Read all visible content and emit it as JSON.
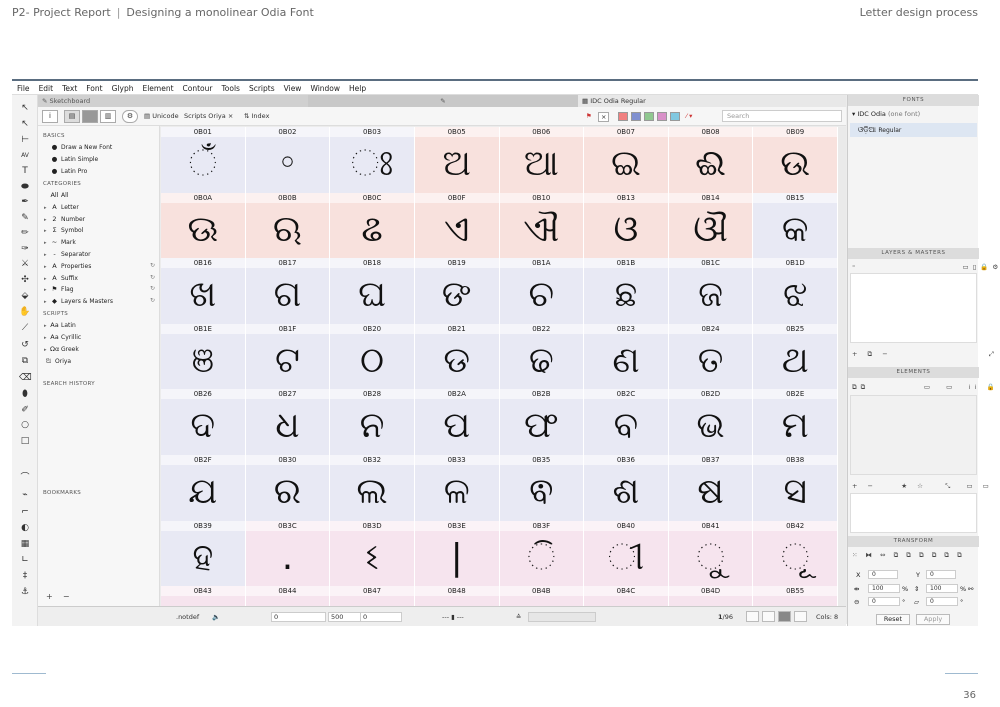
{
  "page": {
    "header_left": "P2- Project Report",
    "header_separator": "|",
    "header_middle": "Designing a monolinear Odia Font",
    "header_right": "Letter design process",
    "page_number": "36"
  },
  "menu": [
    "File",
    "Edit",
    "Text",
    "Font",
    "Glyph",
    "Element",
    "Contour",
    "Tools",
    "Scripts",
    "View",
    "Window",
    "Help"
  ],
  "tabs": {
    "sketchboard": "Sketchboard",
    "middle": "✎ ",
    "font": "IDC Odia Regular"
  },
  "viewbar": {
    "info_btn": "i",
    "unicode": "Unicode",
    "scripts": "Scripts Oriya",
    "scripts_close": "×",
    "index": "Index",
    "search_placeholder": "Search",
    "swatch_colors": [
      "#f08080",
      "#8090d0",
      "#90c890",
      "#d890c8",
      "#80c8e0"
    ]
  },
  "sidebar": {
    "basics_head": "BASICS",
    "basics": [
      "Draw a New Font",
      "Latin Simple",
      "Latin Pro"
    ],
    "categories_head": "CATEGORIES",
    "categories": [
      {
        "icon": "All",
        "label": "All"
      },
      {
        "icon": "A",
        "label": "Letter"
      },
      {
        "icon": "2",
        "label": "Number"
      },
      {
        "icon": "Σ",
        "label": "Symbol"
      },
      {
        "icon": "~",
        "label": "Mark"
      },
      {
        "icon": "-",
        "label": "Separator"
      },
      {
        "icon": "A",
        "label": "Properties"
      },
      {
        "icon": "A",
        "label": "Suffix"
      },
      {
        "icon": "⚑",
        "label": "Flag"
      },
      {
        "icon": "◆",
        "label": "Layers & Masters"
      }
    ],
    "scripts_head": "SCRIPTS",
    "scripts": [
      {
        "icon": "Aa",
        "label": "Latin"
      },
      {
        "icon": "Аа",
        "label": "Cyrillic"
      },
      {
        "icon": "Ωα",
        "label": "Greek"
      },
      {
        "icon": "ଅ",
        "label": "Oriya"
      }
    ],
    "search_history_head": "SEARCH HISTORY",
    "bookmarks_head": "BOOKMARKS",
    "plus": "+",
    "minus": "−"
  },
  "grid": [
    {
      "code": "0B01",
      "glyph": "ଁ",
      "color": "#e8e9f4"
    },
    {
      "code": "0B02",
      "glyph": "◦",
      "color": "#e8e9f4"
    },
    {
      "code": "0B03",
      "glyph": "ଃ",
      "color": "#e8e9f4"
    },
    {
      "code": "0B05",
      "glyph": "ଅ",
      "color": "#f8e1dd"
    },
    {
      "code": "0B06",
      "glyph": "ଆ",
      "color": "#f8e1dd"
    },
    {
      "code": "0B07",
      "glyph": "ଇ",
      "color": "#f8e1dd"
    },
    {
      "code": "0B08",
      "glyph": "ଈ",
      "color": "#f8e1dd"
    },
    {
      "code": "0B09",
      "glyph": "ଉ",
      "color": "#f8e1dd"
    },
    {
      "code": "0B0A",
      "glyph": "ଊ",
      "color": "#f8e1dd"
    },
    {
      "code": "0B0B",
      "glyph": "ଋ",
      "color": "#f8e1dd"
    },
    {
      "code": "0B0C",
      "glyph": "ଌ",
      "color": "#f8e1dd"
    },
    {
      "code": "0B0F",
      "glyph": "ଏ",
      "color": "#f8e1dd"
    },
    {
      "code": "0B10",
      "glyph": "ଐ",
      "color": "#f8e1dd"
    },
    {
      "code": "0B13",
      "glyph": "ଓ",
      "color": "#f8e1dd"
    },
    {
      "code": "0B14",
      "glyph": "ଔ",
      "color": "#f8e1dd"
    },
    {
      "code": "0B15",
      "glyph": "କ",
      "color": "#e8e9f4"
    },
    {
      "code": "0B16",
      "glyph": "ଖ",
      "color": "#e8e9f4"
    },
    {
      "code": "0B17",
      "glyph": "ଗ",
      "color": "#e8e9f4"
    },
    {
      "code": "0B18",
      "glyph": "ଘ",
      "color": "#e8e9f4"
    },
    {
      "code": "0B19",
      "glyph": "ଙ",
      "color": "#e8e9f4"
    },
    {
      "code": "0B1A",
      "glyph": "ଚ",
      "color": "#e8e9f4"
    },
    {
      "code": "0B1B",
      "glyph": "ଛ",
      "color": "#e8e9f4"
    },
    {
      "code": "0B1C",
      "glyph": "ଜ",
      "color": "#e8e9f4"
    },
    {
      "code": "0B1D",
      "glyph": "ଝ",
      "color": "#e8e9f4"
    },
    {
      "code": "0B1E",
      "glyph": "ଞ",
      "color": "#e8e9f4"
    },
    {
      "code": "0B1F",
      "glyph": "ଟ",
      "color": "#e8e9f4"
    },
    {
      "code": "0B20",
      "glyph": "ଠ",
      "color": "#e8e9f4"
    },
    {
      "code": "0B21",
      "glyph": "ଡ",
      "color": "#e8e9f4"
    },
    {
      "code": "0B22",
      "glyph": "ଢ",
      "color": "#e8e9f4"
    },
    {
      "code": "0B23",
      "glyph": "ଣ",
      "color": "#e8e9f4"
    },
    {
      "code": "0B24",
      "glyph": "ତ",
      "color": "#e8e9f4"
    },
    {
      "code": "0B25",
      "glyph": "ଥ",
      "color": "#e8e9f4"
    },
    {
      "code": "0B26",
      "glyph": "ଦ",
      "color": "#e8e9f4"
    },
    {
      "code": "0B27",
      "glyph": "ଧ",
      "color": "#e8e9f4"
    },
    {
      "code": "0B28",
      "glyph": "ନ",
      "color": "#e8e9f4"
    },
    {
      "code": "0B2A",
      "glyph": "ପ",
      "color": "#e8e9f4"
    },
    {
      "code": "0B2B",
      "glyph": "ଫ",
      "color": "#e8e9f4"
    },
    {
      "code": "0B2C",
      "glyph": "ବ",
      "color": "#e8e9f4"
    },
    {
      "code": "0B2D",
      "glyph": "ଭ",
      "color": "#e8e9f4"
    },
    {
      "code": "0B2E",
      "glyph": "ମ",
      "color": "#e8e9f4"
    },
    {
      "code": "0B2F",
      "glyph": "ଯ",
      "color": "#e8e9f4"
    },
    {
      "code": "0B30",
      "glyph": "ର",
      "color": "#e8e9f4"
    },
    {
      "code": "0B32",
      "glyph": "ଲ",
      "color": "#e8e9f4"
    },
    {
      "code": "0B33",
      "glyph": "ଳ",
      "color": "#e8e9f4"
    },
    {
      "code": "0B35",
      "glyph": "ଵ",
      "color": "#e8e9f4"
    },
    {
      "code": "0B36",
      "glyph": "ଶ",
      "color": "#e8e9f4"
    },
    {
      "code": "0B37",
      "glyph": "ଷ",
      "color": "#e8e9f4"
    },
    {
      "code": "0B38",
      "glyph": "ସ",
      "color": "#e8e9f4"
    },
    {
      "code": "0B39",
      "glyph": "ହ",
      "color": "#e8e9f4"
    },
    {
      "code": "0B3C",
      "glyph": ".",
      "color": "#f6e4ee"
    },
    {
      "code": "0B3D",
      "glyph": "ଽ",
      "color": "#f6e4ee"
    },
    {
      "code": "0B3E",
      "glyph": "|",
      "color": "#f6e4ee"
    },
    {
      "code": "0B3F",
      "glyph": "ି",
      "color": "#f6e4ee"
    },
    {
      "code": "0B40",
      "glyph": "ୀ",
      "color": "#f6e4ee"
    },
    {
      "code": "0B41",
      "glyph": "ୁ",
      "color": "#f6e4ee"
    },
    {
      "code": "0B42",
      "glyph": "ୂ",
      "color": "#f6e4ee"
    },
    {
      "code": "0B43",
      "glyph": "",
      "color": "#f6e4ee"
    },
    {
      "code": "0B44",
      "glyph": "",
      "color": "#f6e4ee"
    },
    {
      "code": "0B47",
      "glyph": "",
      "color": "#f6e4ee"
    },
    {
      "code": "0B48",
      "glyph": "",
      "color": "#f6e4ee"
    },
    {
      "code": "0B4B",
      "glyph": "",
      "color": "#f6e4ee"
    },
    {
      "code": "0B4C",
      "glyph": "",
      "color": "#f6e4ee"
    },
    {
      "code": "0B4D",
      "glyph": "",
      "color": "#f6e4ee"
    },
    {
      "code": "0B55",
      "glyph": "",
      "color": "#f6e4ee"
    }
  ],
  "status": {
    "glyph_name": ".notdef",
    "val1": "0",
    "val2": "500",
    "val3": "0",
    "page_count_current": "1",
    "page_count_total": "/96",
    "cols": "Cols: 8"
  },
  "right_panel": {
    "fonts_head": "FONTS",
    "font_name": "IDC Odia",
    "font_count": "(one font)",
    "font_sample": "ଓଡ଼ିଆ",
    "font_style": "Regular",
    "layers_head": "LAYERS & MASTERS",
    "elements_head": "ELEMENTS",
    "transform_head": "TRANSFORM",
    "x_label": "X",
    "x_value": "0",
    "y_label": "Y",
    "y_value": "0",
    "w_value": "100",
    "w_unit": "%",
    "h_value": "100",
    "h_unit": "%",
    "rot_value": "0",
    "rot_unit": "°",
    "skew_value": "0",
    "skew_unit": "°",
    "reset": "Reset",
    "apply": "Apply"
  }
}
